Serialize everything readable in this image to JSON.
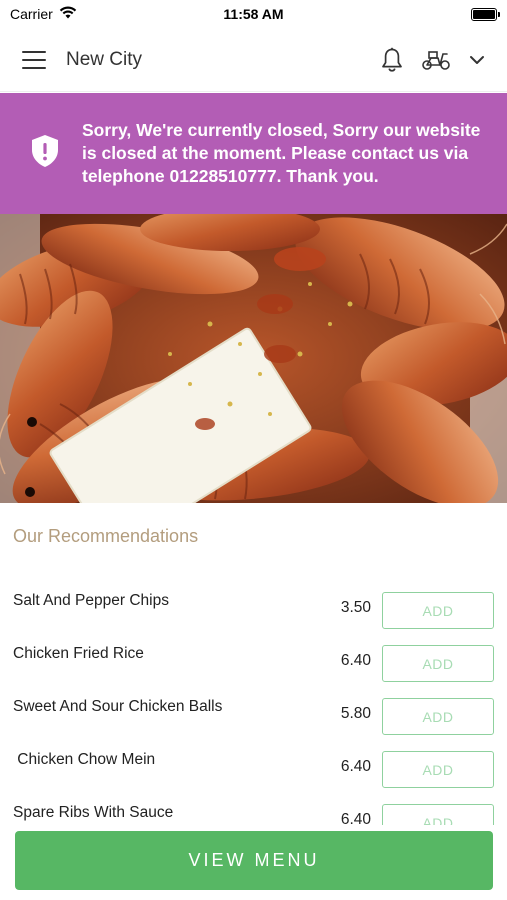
{
  "status_bar": {
    "carrier": "Carrier",
    "time": "11:58 AM"
  },
  "header": {
    "title": "New City",
    "icons": [
      "menu-icon",
      "bell-icon",
      "scooter-icon",
      "chevron-down-icon"
    ]
  },
  "banner": {
    "message": "Sorry, We're currently closed, Sorry our website is closed at the moment. Please contact us via telephone 01228510777. Thank you.",
    "icon": "shield-alert-icon",
    "color": "#b35db5"
  },
  "recommendations": {
    "title": "Our Recommendations",
    "add_label": "ADD",
    "items": [
      {
        "name": "Salt And Pepper Chips",
        "price": "3.50"
      },
      {
        "name": "Chicken Fried Rice",
        "price": "6.40"
      },
      {
        "name": "Sweet And Sour Chicken Balls",
        "price": "5.80"
      },
      {
        "name": " Chicken Chow Mein",
        "price": "6.40"
      },
      {
        "name": "Spare Ribs With Sauce",
        "price": "6.40"
      }
    ]
  },
  "view_menu": {
    "label": "VIEW MENU",
    "color": "#57b764"
  }
}
